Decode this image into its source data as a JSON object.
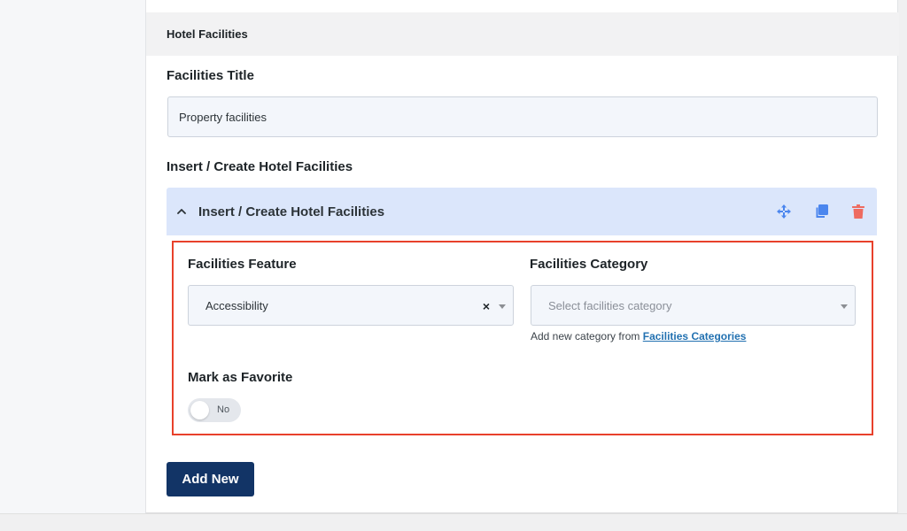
{
  "section": {
    "header": "Hotel Facilities"
  },
  "facilities_title": {
    "label": "Facilities Title",
    "value": "Property facilities"
  },
  "insert_section": {
    "label": "Insert / Create Hotel Facilities"
  },
  "repeater": {
    "title": "Insert / Create Hotel Facilities",
    "actions": {
      "move_icon": "move-icon",
      "duplicate_icon": "duplicate-icon",
      "delete_icon": "trash-icon"
    },
    "feature": {
      "label": "Facilities Feature",
      "selected": "Accessibility",
      "clear": "×"
    },
    "category": {
      "label": "Facilities Category",
      "placeholder": "Select facilities category",
      "help_prefix": "Add new category from",
      "help_link": "Facilities Categories"
    },
    "favorite": {
      "label": "Mark as Favorite",
      "toggle_text": "No",
      "enabled": false
    }
  },
  "add_button": {
    "label": "Add New"
  },
  "colors": {
    "accent_blue": "#4b86ee",
    "delete_red": "#ee6b60",
    "primary_button": "#123466",
    "highlight": "#e8412b",
    "repeater_head": "#dbe6fb"
  }
}
